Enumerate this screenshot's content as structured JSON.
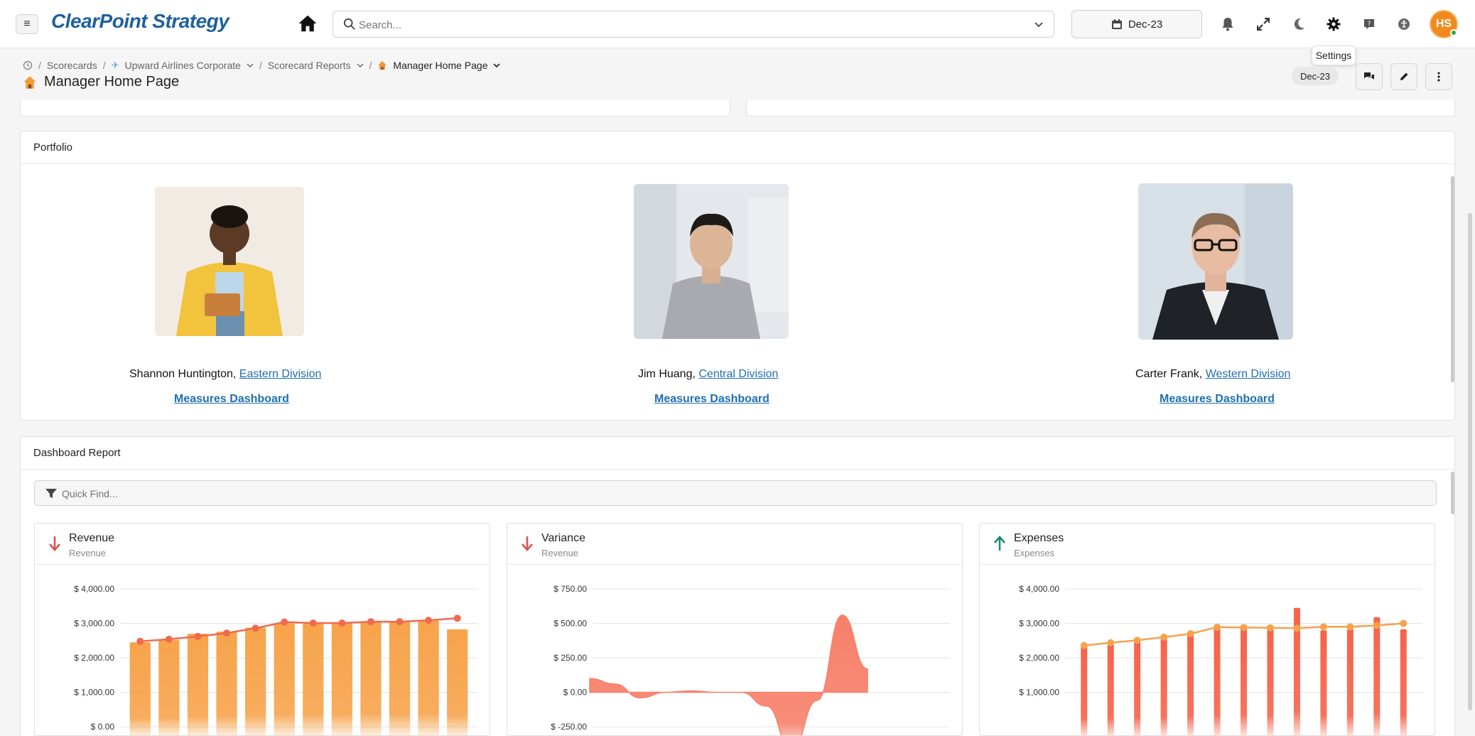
{
  "app": {
    "logo": "ClearPoint Strategy"
  },
  "search": {
    "placeholder": "Search..."
  },
  "period": {
    "label": "Dec-23"
  },
  "user": {
    "initials": "HS"
  },
  "tooltip": {
    "text": "Settings"
  },
  "breadcrumb": {
    "items": [
      "Scorecards",
      "Upward Airlines Corporate",
      "Scorecard Reports",
      "Manager Home Page"
    ]
  },
  "page": {
    "title": "Manager Home Page",
    "period_badge": "Dec-23"
  },
  "portfolio": {
    "title": "Portfolio",
    "people": [
      {
        "name": "Shannon Huntington",
        "division": "Eastern Division",
        "link": "Measures Dashboard"
      },
      {
        "name": "Jim Huang",
        "division": "Central Division",
        "link": "Measures Dashboard"
      },
      {
        "name": "Carter Frank",
        "division": "Western Division",
        "link": "Measures Dashboard"
      }
    ]
  },
  "dashboard": {
    "title": "Dashboard Report",
    "quick_find_placeholder": "Quick Find..."
  },
  "cards": [
    {
      "title": "Revenue",
      "subtitle": "Revenue",
      "trend": "down",
      "trend_color": "#d9534f"
    },
    {
      "title": "Variance",
      "subtitle": "Revenue",
      "trend": "down",
      "trend_color": "#d9534f"
    },
    {
      "title": "Expenses",
      "subtitle": "Expenses",
      "trend": "up",
      "trend_color": "#1a8a73"
    }
  ],
  "chart_data": [
    {
      "type": "bar",
      "title": "Revenue",
      "yticks": [
        "$ 4,000.00",
        "$ 3,000.00",
        "$ 2,000.00",
        "$ 1,000.00",
        "$ 0.00"
      ],
      "ylim": [
        0,
        4000
      ],
      "series": [
        {
          "type": "bar",
          "color": "#f7a34b",
          "values": [
            2450,
            2520,
            2700,
            2760,
            2880,
            3000,
            3000,
            3000,
            3040,
            3050,
            3080,
            2830
          ]
        },
        {
          "type": "line",
          "color": "#ef6a4f",
          "values": [
            2480,
            2540,
            2620,
            2720,
            2860,
            3040,
            3010,
            3010,
            3050,
            3050,
            3090,
            3150
          ]
        }
      ]
    },
    {
      "type": "area",
      "title": "Variance",
      "yticks": [
        "$ 750.00",
        "$ 500.00",
        "$ 250.00",
        "$ 0.00",
        "$ -250.00"
      ],
      "ylim": [
        -250,
        750
      ],
      "series": [
        {
          "type": "area",
          "color": "#f7806a",
          "values": [
            100,
            60,
            -40,
            0,
            10,
            0,
            0,
            -100,
            -420,
            -60,
            560,
            170
          ]
        }
      ]
    },
    {
      "type": "bar",
      "title": "Expenses",
      "yticks": [
        "$ 4,000.00",
        "$ 3,000.00",
        "$ 2,000.00",
        "$ 1,000.00"
      ],
      "ylim": [
        1000,
        4000
      ],
      "series": [
        {
          "type": "bar",
          "color": "#f5634a",
          "values": [
            2380,
            2400,
            2500,
            2630,
            2730,
            2900,
            2960,
            2930,
            3450,
            2800,
            2830,
            3180,
            2830
          ]
        },
        {
          "type": "line",
          "color": "#f6a24c",
          "values": [
            2360,
            2440,
            2510,
            2600,
            2700,
            2890,
            2880,
            2870,
            2860,
            2900,
            2900,
            2940,
            3000
          ]
        }
      ]
    }
  ]
}
